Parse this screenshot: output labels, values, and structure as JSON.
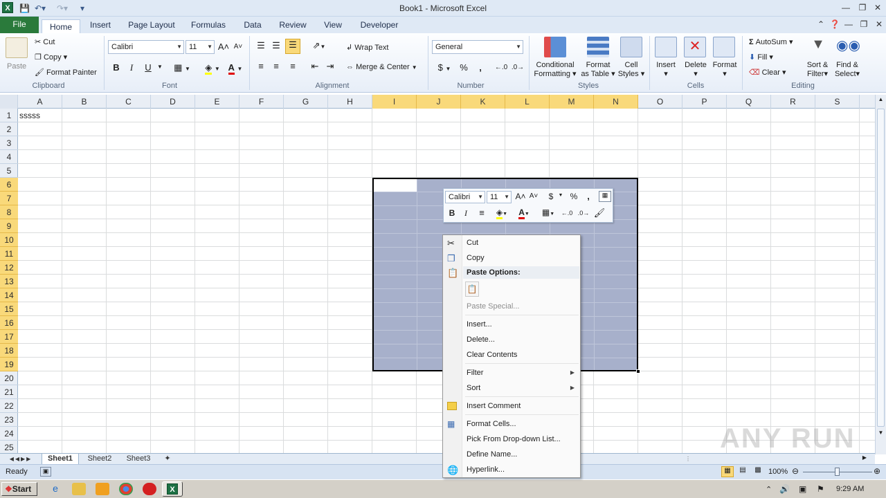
{
  "window": {
    "title": "Book1 - Microsoft Excel",
    "app_icon": "X"
  },
  "tabs": [
    "File",
    "Home",
    "Insert",
    "Page Layout",
    "Formulas",
    "Data",
    "Review",
    "View",
    "Developer"
  ],
  "ribbon": {
    "clipboard": {
      "paste": "Paste",
      "cut": "Cut",
      "copy": "Copy",
      "format_painter": "Format Painter",
      "label": "Clipboard"
    },
    "font": {
      "name": "Calibri",
      "size": "11",
      "bold": "B",
      "italic": "I",
      "underline": "U",
      "label": "Font"
    },
    "alignment": {
      "wrap_text": "Wrap Text",
      "merge_center": "Merge & Center",
      "label": "Alignment"
    },
    "number": {
      "format": "General",
      "currency": "$",
      "percent": "%",
      "comma": ",",
      "label": "Number"
    },
    "styles": {
      "conditional": "Conditional",
      "conditional2": "Formatting",
      "format_table": "Format",
      "format_table2": "as Table",
      "cell_styles": "Cell",
      "cell_styles2": "Styles",
      "label": "Styles"
    },
    "cells": {
      "insert": "Insert",
      "delete": "Delete",
      "format": "Format",
      "label": "Cells"
    },
    "editing": {
      "autosum": "AutoSum",
      "fill": "Fill",
      "clear": "Clear",
      "sort": "Sort &",
      "sort2": "Filter",
      "find": "Find &",
      "find2": "Select",
      "label": "Editing"
    }
  },
  "columns": [
    "A",
    "B",
    "C",
    "D",
    "E",
    "F",
    "G",
    "H",
    "I",
    "J",
    "K",
    "L",
    "M",
    "N",
    "O",
    "P",
    "Q",
    "R",
    "S"
  ],
  "rows": [
    "1",
    "2",
    "3",
    "4",
    "5",
    "6",
    "7",
    "8",
    "9",
    "10",
    "11",
    "12",
    "13",
    "14",
    "15",
    "16",
    "17",
    "18",
    "19",
    "20",
    "21",
    "22",
    "23",
    "24",
    "25"
  ],
  "cell_a1": "sssss",
  "mini_toolbar": {
    "font": "Calibri",
    "size": "11",
    "currency": "$",
    "percent": "%",
    "comma": ",",
    "bold": "B",
    "italic": "I"
  },
  "context_menu": {
    "cut": "Cut",
    "copy": "Copy",
    "paste_options": "Paste Options:",
    "paste_special": "Paste Special...",
    "insert": "Insert...",
    "delete": "Delete...",
    "clear_contents": "Clear Contents",
    "filter": "Filter",
    "sort": "Sort",
    "insert_comment": "Insert Comment",
    "format_cells": "Format Cells...",
    "pick_list": "Pick From Drop-down List...",
    "define_name": "Define Name...",
    "hyperlink": "Hyperlink..."
  },
  "sheets": [
    "Sheet1",
    "Sheet2",
    "Sheet3"
  ],
  "status": {
    "ready": "Ready",
    "zoom": "100%"
  },
  "taskbar": {
    "start": "Start",
    "time": "9:29 AM"
  },
  "watermark": "ANY RUN"
}
